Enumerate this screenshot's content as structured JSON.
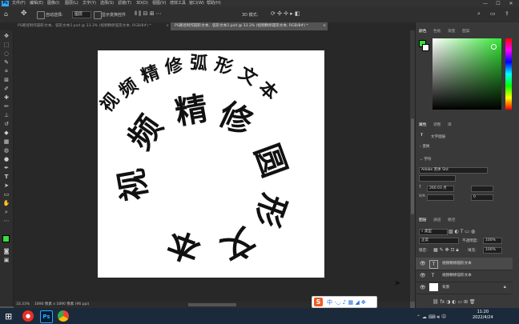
{
  "menu": {
    "logo": "Ps",
    "items": [
      "文件(F)",
      "编辑(E)",
      "图像(I)",
      "图层(L)",
      "文字(Y)",
      "选择(S)",
      "滤镜(T)",
      "3D(D)",
      "视图(V)",
      "增效工具",
      "窗口(W)",
      "帮助(H)"
    ]
  },
  "window_controls": [
    "—",
    "☐",
    "✕"
  ],
  "options": {
    "auto_select_label": "自动选择:",
    "auto_select_value": "图层",
    "show_transform": "显示变换控件",
    "mode_3d": "3D 模式:"
  },
  "tabs": [
    {
      "label": "PS路径制作圆形文本、弧形文本2.psd @ 33.3% (视频精修弧形文本, RGB/8#) *",
      "active": false
    },
    {
      "label": "PS路径制作圆形文本、弧形文本2.psd @ 33.3% (视频精修圆形文本, RGB/8#) *",
      "active": true
    }
  ],
  "canvas_text": {
    "arc_top": [
      "视",
      "频",
      "精",
      "修",
      "弧",
      "形",
      "文",
      "本"
    ],
    "circle": [
      "视",
      "频",
      "精",
      "修",
      "圆",
      "形",
      "文",
      "本"
    ]
  },
  "status": {
    "zoom": "33.33%",
    "size": "1890 像素 x 1890 像素 (96 ppi)"
  },
  "panels": {
    "color_tabs": [
      "颜色",
      "色板",
      "渐变",
      "图案"
    ],
    "props_tabs": [
      "属性",
      "调整",
      "库"
    ],
    "layer_type": "文字图层",
    "transform": "变换",
    "character": "字符",
    "font_name": "Adobe 黑体 Std",
    "font_size": "260.03 点",
    "tracking": "0",
    "layers_tabs": [
      "图层",
      "通道",
      "路径"
    ],
    "kind": "类型",
    "blend_mode": "正常",
    "opacity_label": "不透明度:",
    "opacity": "100%",
    "lock_label": "锁定:",
    "fill_label": "填充:",
    "fill": "100%"
  },
  "layers": [
    {
      "name": "视频精修圆形文本",
      "type": "T",
      "selected": true
    },
    {
      "name": "视频精修弧形文本",
      "type": "T",
      "selected": false
    },
    {
      "name": "背景",
      "type": "bg",
      "selected": false
    }
  ],
  "taskbar": {
    "time": "11:20",
    "date": "2022/4/24"
  },
  "colors": {
    "foreground": "#35e03a",
    "background": "#ffffff",
    "accent": "#31a8ff"
  }
}
